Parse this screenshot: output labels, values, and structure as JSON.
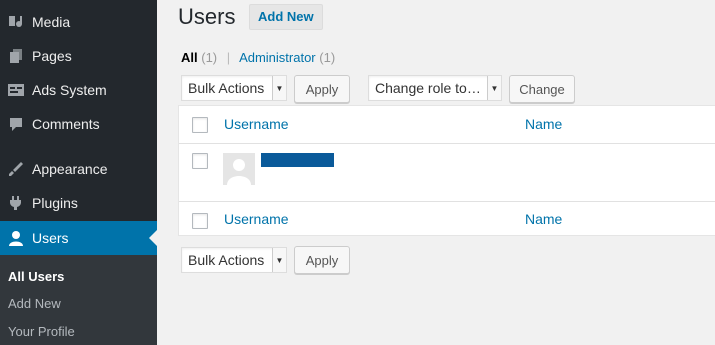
{
  "sidebar": {
    "items": [
      {
        "label": "Media",
        "icon": "media-icon"
      },
      {
        "label": "Pages",
        "icon": "pages-icon"
      },
      {
        "label": "Ads System",
        "icon": "ads-icon"
      },
      {
        "label": "Comments",
        "icon": "comments-icon"
      },
      {
        "label": "Appearance",
        "icon": "appearance-icon"
      },
      {
        "label": "Plugins",
        "icon": "plugins-icon"
      },
      {
        "label": "Users",
        "icon": "users-icon",
        "active": true
      }
    ],
    "submenu": [
      {
        "label": "All Users",
        "current": true
      },
      {
        "label": "Add New"
      },
      {
        "label": "Your Profile"
      }
    ]
  },
  "header": {
    "title": "Users",
    "add_new_label": "Add New"
  },
  "filters": {
    "all_label": "All",
    "all_count": "(1)",
    "separator": "|",
    "admin_label": "Administrator",
    "admin_count": "(1)"
  },
  "toolbar_top": {
    "bulk_actions": "Bulk Actions",
    "apply": "Apply",
    "change_role": "Change role to…",
    "change": "Change"
  },
  "table": {
    "columns": [
      "Username",
      "Name"
    ]
  },
  "toolbar_bottom": {
    "bulk_actions": "Bulk Actions",
    "apply": "Apply"
  },
  "colors": {
    "accent": "#0073aa",
    "sidebar_bg": "#23282d",
    "submenu_bg": "#32373c"
  }
}
